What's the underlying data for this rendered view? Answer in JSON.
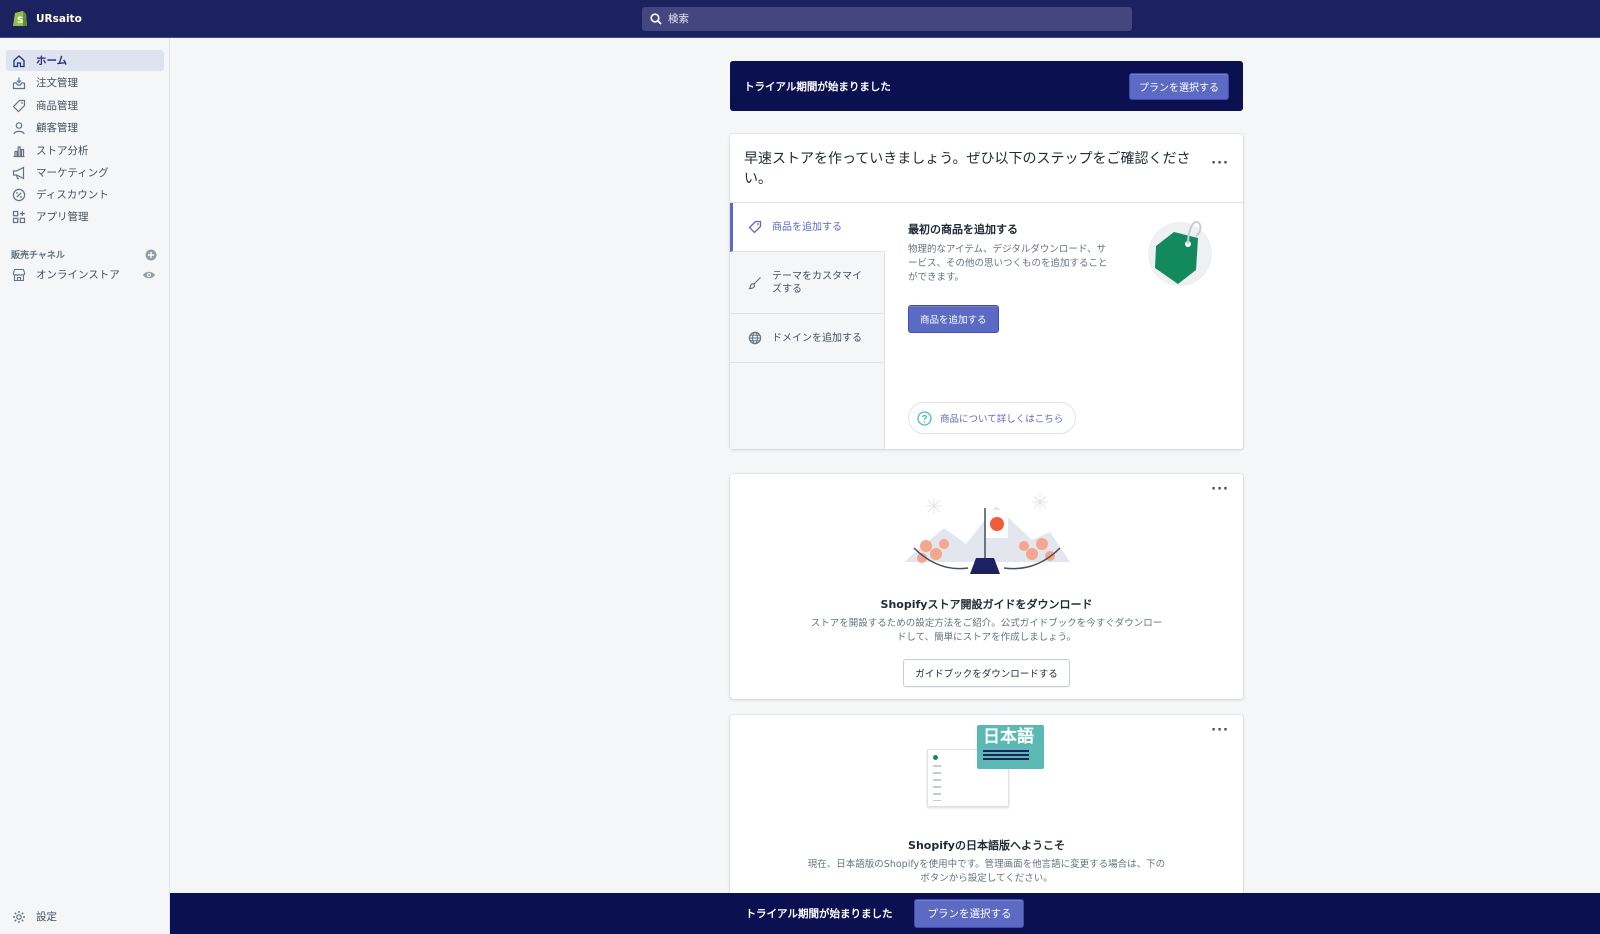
{
  "topbar": {
    "store_name": "URsaito",
    "search_placeholder": "検索"
  },
  "sidebar": {
    "items": [
      {
        "label": "ホーム",
        "icon": "home-icon"
      },
      {
        "label": "注文管理",
        "icon": "orders-icon"
      },
      {
        "label": "商品管理",
        "icon": "tag-icon"
      },
      {
        "label": "顧客管理",
        "icon": "person-icon"
      },
      {
        "label": "ストア分析",
        "icon": "bar-chart-icon"
      },
      {
        "label": "マーケティング",
        "icon": "megaphone-icon"
      },
      {
        "label": "ディスカウント",
        "icon": "discount-icon"
      },
      {
        "label": "アプリ管理",
        "icon": "apps-icon"
      }
    ],
    "channels_heading": "販売チャネル",
    "online_store_label": "オンラインストア",
    "settings_label": "設定"
  },
  "trial_banner": {
    "text": "トライアル期間が始まりました",
    "button_label": "プランを選択する"
  },
  "setup_card": {
    "title": "早速ストアを作っていきましょう。ぜひ以下のステップをご確認ください。",
    "steps": [
      {
        "label": "商品を追加する",
        "icon": "tag-icon"
      },
      {
        "label": "テーマをカスタマイズする",
        "icon": "brush-icon"
      },
      {
        "label": "ドメインを追加する",
        "icon": "globe-icon"
      }
    ],
    "detail_title": "最初の商品を追加する",
    "detail_text": "物理的なアイテム、デジタルダウンロード、サービス、その他の思いつくものを追加することができます。",
    "detail_button": "商品を追加する",
    "learn_more": "商品について詳しくはこちら"
  },
  "guide_card": {
    "title": "Shopifyストア開設ガイドをダウンロード",
    "text": "ストアを開設するための設定方法をご紹介。公式ガイドブックを今すぐダウンロードして、簡単にストアを作成しましょう。",
    "button_label": "ガイドブックをダウンロードする"
  },
  "japanese_card": {
    "illustration_text": "日本語",
    "title": "Shopifyの日本語版へようこそ",
    "text": "現在、日本語版のShopifyを使用中です。管理画面を他言語に変更する場合は、下のボタンから設定してください。"
  },
  "bottom_bar": {
    "text": "トライアル期間が始まりました",
    "button_label": "プランを選択する"
  },
  "colors": {
    "topbar": "#1c2260",
    "banner": "#0b1050",
    "accent": "#5c6ac4",
    "brand_green": "#95bf47",
    "tag_green": "#138a5e",
    "flower": "#f4a78d",
    "sun": "#ef5d3b"
  }
}
